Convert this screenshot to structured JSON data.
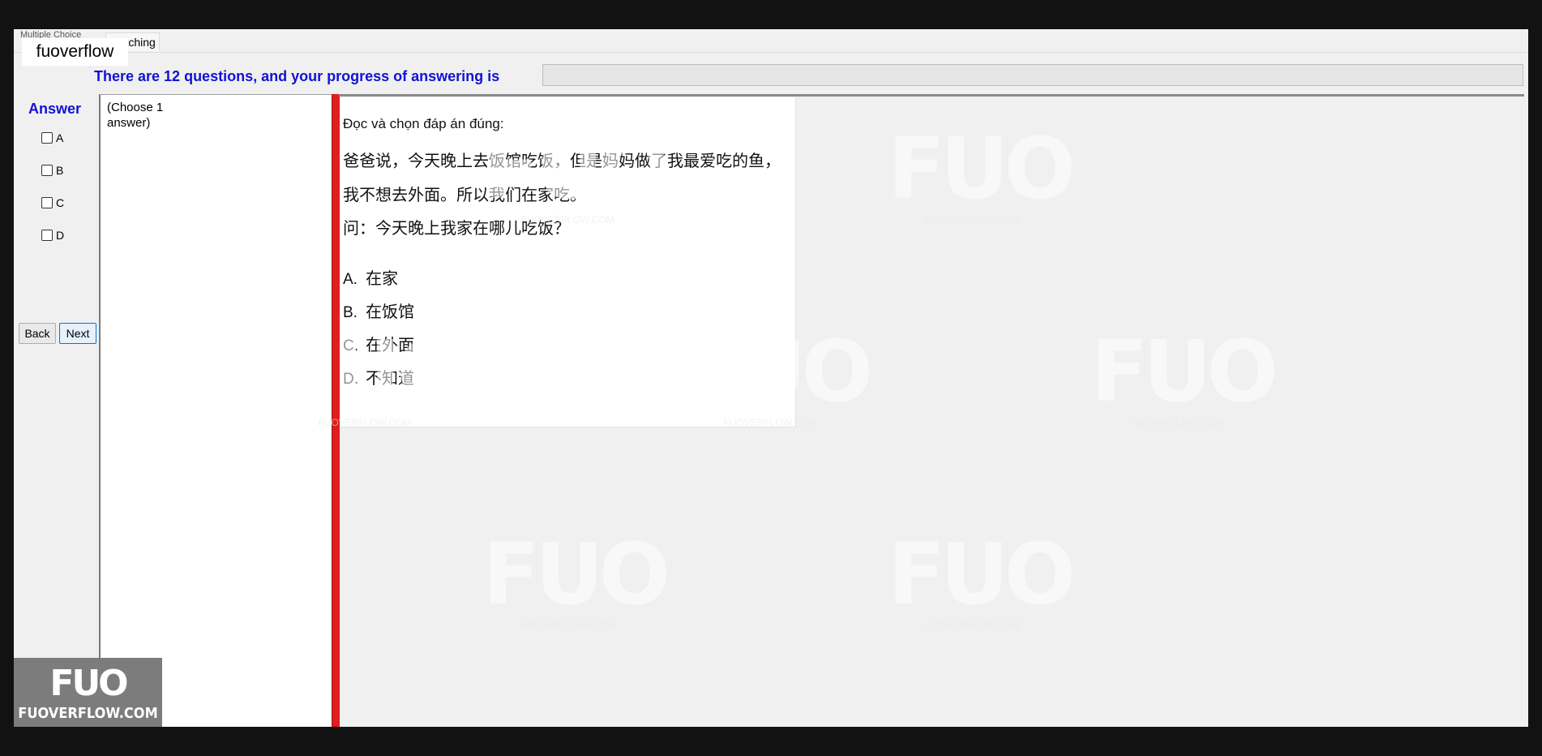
{
  "tabs": {
    "multiple": "Multiple Choice",
    "matching": "Matching"
  },
  "site_label": "fuoverflow",
  "progress": {
    "text": "There are 12 questions, and your progress of answering is",
    "value": 0
  },
  "answer_panel": {
    "title": "Answer",
    "options": [
      "A",
      "B",
      "C",
      "D"
    ],
    "back_label": "Back",
    "next_label": "Next"
  },
  "choose_hint": "(Choose 1 answer)",
  "question": {
    "intro": "Đọc và chọn đáp án đúng:",
    "line1": "爸爸说，今天晚上去饭馆吃饭，但是妈妈做了我最爱吃的鱼，",
    "line2": "我不想去外面。所以我们在家吃。",
    "line3": "问：今天晚上我家在哪儿吃饭？",
    "options": [
      {
        "key": "A.",
        "text": "在家"
      },
      {
        "key": "B.",
        "text": "在饭馆"
      },
      {
        "key": "C.",
        "text": "在外面"
      },
      {
        "key": "D.",
        "text": "不知道"
      }
    ]
  },
  "watermark": {
    "mark": "FUO",
    "text": "FUOVERFLOW.COM"
  },
  "corner_logo": {
    "mark": "FUO",
    "text": "FUOVERFLOW.COM"
  },
  "colors": {
    "accent_blue": "#1212d6",
    "divider_red": "#e11d1d"
  }
}
